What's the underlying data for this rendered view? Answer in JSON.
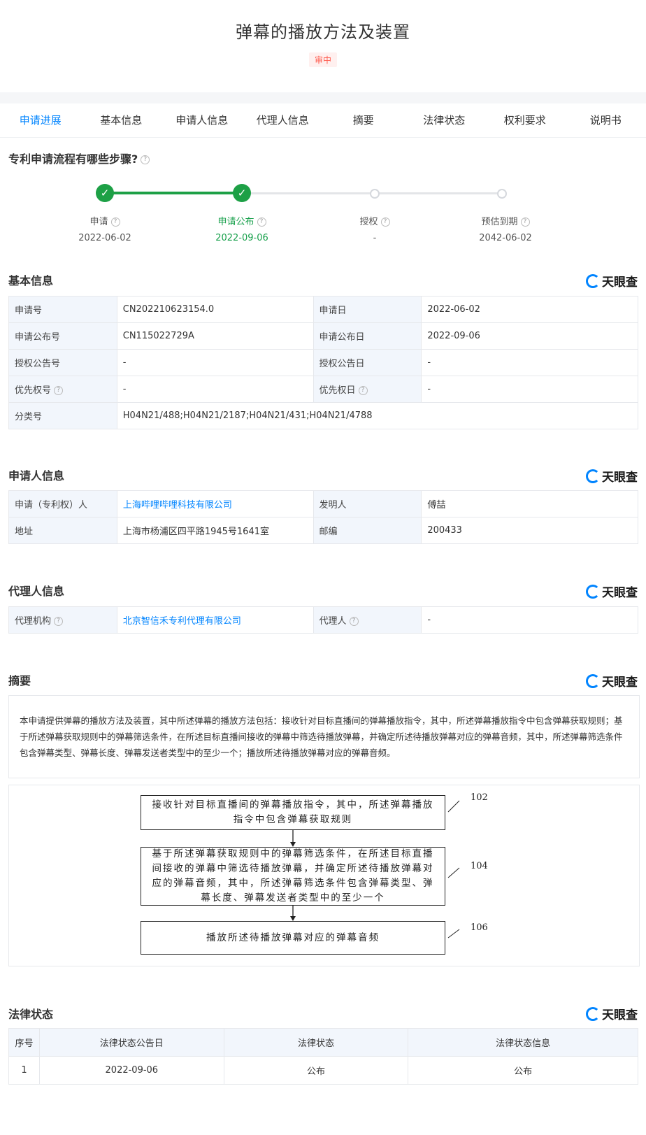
{
  "header": {
    "title": "弹幕的播放方法及装置",
    "status_badge": "审中"
  },
  "tabs": [
    "申请进展",
    "基本信息",
    "申请人信息",
    "代理人信息",
    "摘要",
    "法律状态",
    "权利要求",
    "说明书"
  ],
  "active_tab": "申请进展",
  "progress": {
    "title": "专利申请流程有哪些步骤?",
    "steps": [
      {
        "label": "申请",
        "date": "2022-06-02",
        "done": true
      },
      {
        "label": "申请公布",
        "date": "2022-09-06",
        "done": true
      },
      {
        "label": "授权",
        "date": "-",
        "done": false
      },
      {
        "label": "预估到期",
        "date": "2042-06-02",
        "done": false
      }
    ]
  },
  "brand": {
    "logo_text": "天眼查",
    "logo_icon": "tianyancha-logo-icon",
    "accent": "#0084ff",
    "green": "#1da046"
  },
  "basic_info": {
    "title": "基本信息",
    "rows": [
      {
        "k1": "申请号",
        "v1": "CN202210623154.0",
        "k2": "申请日",
        "v2": "2022-06-02"
      },
      {
        "k1": "申请公布号",
        "v1": "CN115022729A",
        "k2": "申请公布日",
        "v2": "2022-09-06"
      },
      {
        "k1": "授权公告号",
        "v1": "-",
        "k2": "授权公告日",
        "v2": "-"
      },
      {
        "k1": "优先权号",
        "v1": "-",
        "k2": "优先权日",
        "v2": "-"
      }
    ],
    "class_key": "分类号",
    "class_value": "H04N21/488;H04N21/2187;H04N21/431;H04N21/4788"
  },
  "applicant_info": {
    "title": "申请人信息",
    "applicant_key": "申请（专利权）人",
    "applicant_value": "上海哔哩哔哩科技有限公司",
    "inventor_key": "发明人",
    "inventor_value": "傅喆",
    "address_key": "地址",
    "address_value": "上海市杨浦区四平路1945号1641室",
    "zip_key": "邮编",
    "zip_value": "200433"
  },
  "agent_info": {
    "title": "代理人信息",
    "agency_key": "代理机构",
    "agency_value": "北京智信禾专利代理有限公司",
    "agent_key": "代理人",
    "agent_value": "-"
  },
  "abstract": {
    "title": "摘要",
    "text": "本申请提供弹幕的播放方法及装置，其中所述弹幕的播放方法包括：接收针对目标直播间的弹幕播放指令，其中，所述弹幕播放指令中包含弹幕获取规则；基于所述弹幕获取规则中的弹幕筛选条件，在所述目标直播间接收的弹幕中筛选待播放弹幕，并确定所述待播放弹幕对应的弹幕音频，其中，所述弹幕筛选条件包含弹幕类型、弹幕长度、弹幕发送者类型中的至少一个；播放所述待播放弹幕对应的弹幕音频。",
    "figure": [
      {
        "num": "102",
        "text": "接收针对目标直播间的弹幕播放指令，其中，所述弹幕播放指令中包含弹幕获取规则"
      },
      {
        "num": "104",
        "text": "基于所述弹幕获取规则中的弹幕筛选条件，在所述目标直播间接收的弹幕中筛选待播放弹幕，并确定所述待播放弹幕对应的弹幕音频，其中，所述弹幕筛选条件包含弹幕类型、弹幕长度、弹幕发送者类型中的至少一个"
      },
      {
        "num": "106",
        "text": "播放所述待播放弹幕对应的弹幕音频"
      }
    ]
  },
  "legal_status": {
    "title": "法律状态",
    "headers": [
      "序号",
      "法律状态公告日",
      "法律状态",
      "法律状态信息"
    ],
    "rows": [
      [
        "1",
        "2022-09-06",
        "公布",
        "公布"
      ]
    ]
  }
}
